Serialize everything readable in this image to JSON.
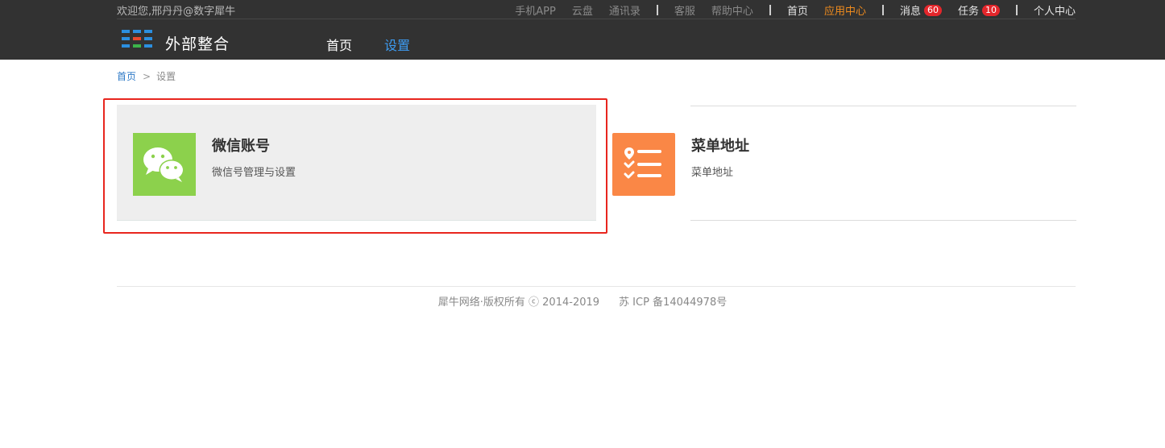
{
  "topbar": {
    "welcome": "欢迎您,邢丹丹@数字犀牛",
    "links": {
      "mobile_app": "手机APP",
      "cloud_disk": "云盘",
      "contacts": "通讯录",
      "customer_service": "客服",
      "help_center": "帮助中心",
      "home": "首页",
      "app_center": "应用中心",
      "messages": "消息",
      "messages_count": "60",
      "tasks": "任务",
      "tasks_count": "10",
      "profile": "个人中心"
    }
  },
  "header": {
    "app_title": "外部整合",
    "nav": {
      "home": "首页",
      "settings": "设置"
    }
  },
  "breadcrumb": {
    "home": "首页",
    "separator": ">",
    "current": "设置"
  },
  "cards": {
    "wechat": {
      "title": "微信账号",
      "description": "微信号管理与设置",
      "icon": "wechat-icon"
    },
    "menu": {
      "title": "菜单地址",
      "description": "菜单地址",
      "icon": "menu-list-icon"
    }
  },
  "footer": {
    "copyright": "犀牛网络·版权所有 ⓒ 2014-2019",
    "icp": "苏 ICP 备14044978号"
  },
  "colors": {
    "topbar_bg": "#323232",
    "accent_orange": "#f08c1e",
    "nav_active_blue": "#3d9bf0",
    "wechat_green": "#8cd14c",
    "menu_orange": "#fa8746",
    "badge_red": "#e4262b",
    "highlight_red": "#e8261e"
  }
}
